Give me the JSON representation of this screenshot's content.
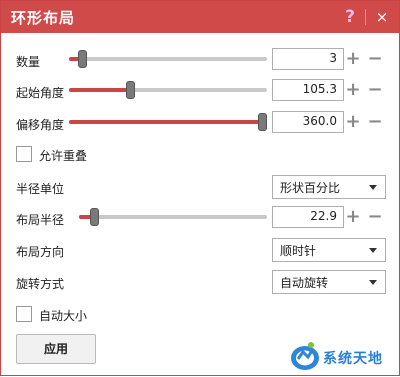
{
  "window": {
    "title": "环形布局",
    "help": "?",
    "close": "×",
    "accent_color": "#d04a4a"
  },
  "controls": {
    "count": {
      "label": "数量",
      "value": "3",
      "slider_fraction": 0.05
    },
    "start_angle": {
      "label": "起始角度",
      "value": "105.3",
      "slider_fraction": 0.3
    },
    "offset_angle": {
      "label": "偏移角度",
      "value": "360.0",
      "slider_fraction": 1.0
    },
    "allow_overlap": {
      "label": "允许重叠",
      "checked": false
    },
    "radius_unit": {
      "label": "半径单位",
      "selected": "形状百分比"
    },
    "layout_radius": {
      "label": "布局半径",
      "value": "22.9",
      "slider_fraction": 0.06
    },
    "layout_direction": {
      "label": "布局方向",
      "selected": "顺时针"
    },
    "rotation_mode": {
      "label": "旋转方式",
      "selected": "自动旋转"
    },
    "auto_size": {
      "label": "自动大小",
      "checked": false
    }
  },
  "buttons": {
    "apply": "应用",
    "plus": "+",
    "minus": "−"
  },
  "watermark": {
    "text": "系统天地",
    "icon": "watermark-logo-icon"
  }
}
